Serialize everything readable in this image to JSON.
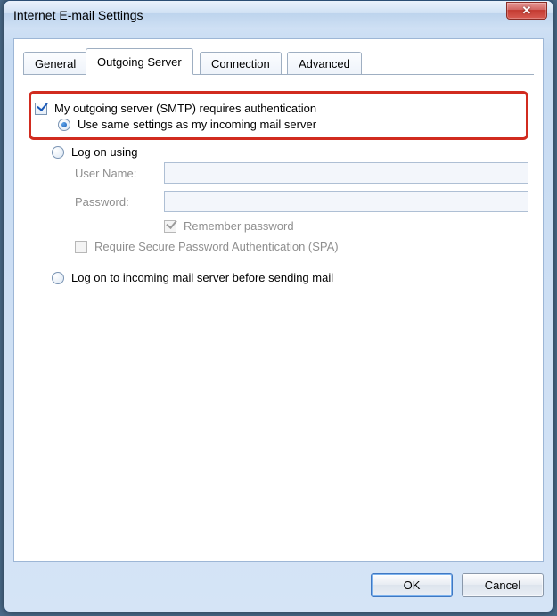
{
  "window": {
    "title": "Internet E-mail Settings"
  },
  "tabs": {
    "general": "General",
    "outgoing": "Outgoing Server",
    "connection": "Connection",
    "advanced": "Advanced",
    "active": "outgoing"
  },
  "form": {
    "requires_auth": {
      "label": "My outgoing server (SMTP) requires authentication",
      "checked": true
    },
    "use_same": {
      "label": "Use same settings as my incoming mail server",
      "selected": true
    },
    "logon_using": {
      "label": "Log on using",
      "selected": false
    },
    "username": {
      "label": "User Name:",
      "value": ""
    },
    "password": {
      "label": "Password:",
      "value": ""
    },
    "remember_pw": {
      "label": "Remember password",
      "checked": true
    },
    "require_spa": {
      "label": "Require Secure Password Authentication (SPA)",
      "checked": false
    },
    "logon_before_send": {
      "label": "Log on to incoming mail server before sending mail",
      "selected": false
    }
  },
  "buttons": {
    "ok": "OK",
    "cancel": "Cancel"
  }
}
